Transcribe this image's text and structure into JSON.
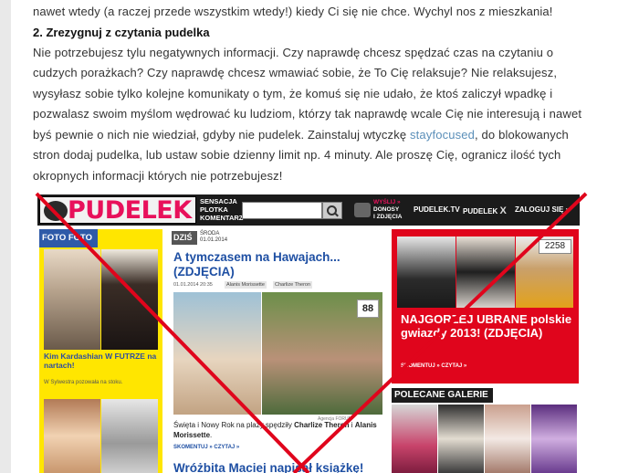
{
  "article": {
    "line_intro": "nawet wtedy (a raczej przede wszystkim wtedy!) kiedy Ci się nie chce. Wychyl nos z mieszkania!",
    "heading": "2. Zrezygnuj z czytania pudelka",
    "paragraph_before_link": " Nie potrzebujesz tylu negatywnych informacji. Czy naprawdę chcesz spędzać czas na czytaniu o cudzych porażkach? Czy naprawdę chcesz wmawiać sobie, że To Cię relaksuje? Nie relaksujesz, wysyłasz sobie tylko kolejne komunikaty o tym, że komuś się nie udało, że ktoś zaliczył wpadkę i pozwalasz swoim myślom wędrować ku ludziom, którzy tak naprawdę wcale Cię nie interesują i nawet byś pewnie o nich nie wiedział, gdyby nie pudelek. Zainstaluj wtyczkę ",
    "link_text": "stayfocused",
    "paragraph_after_link": ", do blokowanych stron dodaj pudelka, lub ustaw sobie dzienny limit np. 4 minuty. Ale proszę Cię, ogranicz ilość tych okropnych informacji których nie potrzebujesz!"
  },
  "screenshot": {
    "header": {
      "logo": "PUDELEK",
      "slogan": [
        "SENSACJA",
        "PLOTKA",
        "KOMENTARZ"
      ],
      "send_lines": [
        "WYŚLIJ »",
        "DONOSY",
        "I ZDJĘCIA"
      ],
      "nav_tv": "PUDELEK.TV",
      "nav_x": "PUDELEK",
      "nav_x_mark": "X",
      "nav_login": "ZALOGUJ SIĘ »"
    },
    "foto_foto": {
      "label": "FOTO FOTO",
      "caption": "Kim Kardashian W FUTRZE na nartach!",
      "sub": "W Sylwestra pozowała na stoku."
    },
    "middle": {
      "dzis": "DZIŚ",
      "day": "ŚRODA",
      "date": "01.01.2014",
      "title": "A tymczasem na Hawajach... (ZDJĘCIA)",
      "meta": "01.01.2014 20:35",
      "tags": [
        "Alanis Morissette",
        "Charlize Theron"
      ],
      "photo_count": "88",
      "credit": "Agencja FORUM",
      "caption_before": "Święta i Nowy Rok na plaży spędziły ",
      "caption_name1": "Charlize Theron",
      "caption_mid": " i ",
      "caption_name2": "Alanis Morissette",
      "caption_after": ".",
      "link_comment": "SKOMENTUJ »",
      "link_read": "CZYTAJ »",
      "title2": "Wróżbita Maciej napisał książkę!"
    },
    "right": {
      "count": "2258",
      "title": "NAJGORZEJ UBRANE polskie gwiazdy 2013! (ZDJĘCIA)",
      "link_comment": "SKOMENTUJ »",
      "link_read": "CZYTAJ »",
      "galleries_label": "POLECANE GALERIE"
    }
  },
  "colors": {
    "accent_pink": "#e8115b",
    "link_blue": "#5b8fb9",
    "crossout_red": "#e0051c"
  }
}
